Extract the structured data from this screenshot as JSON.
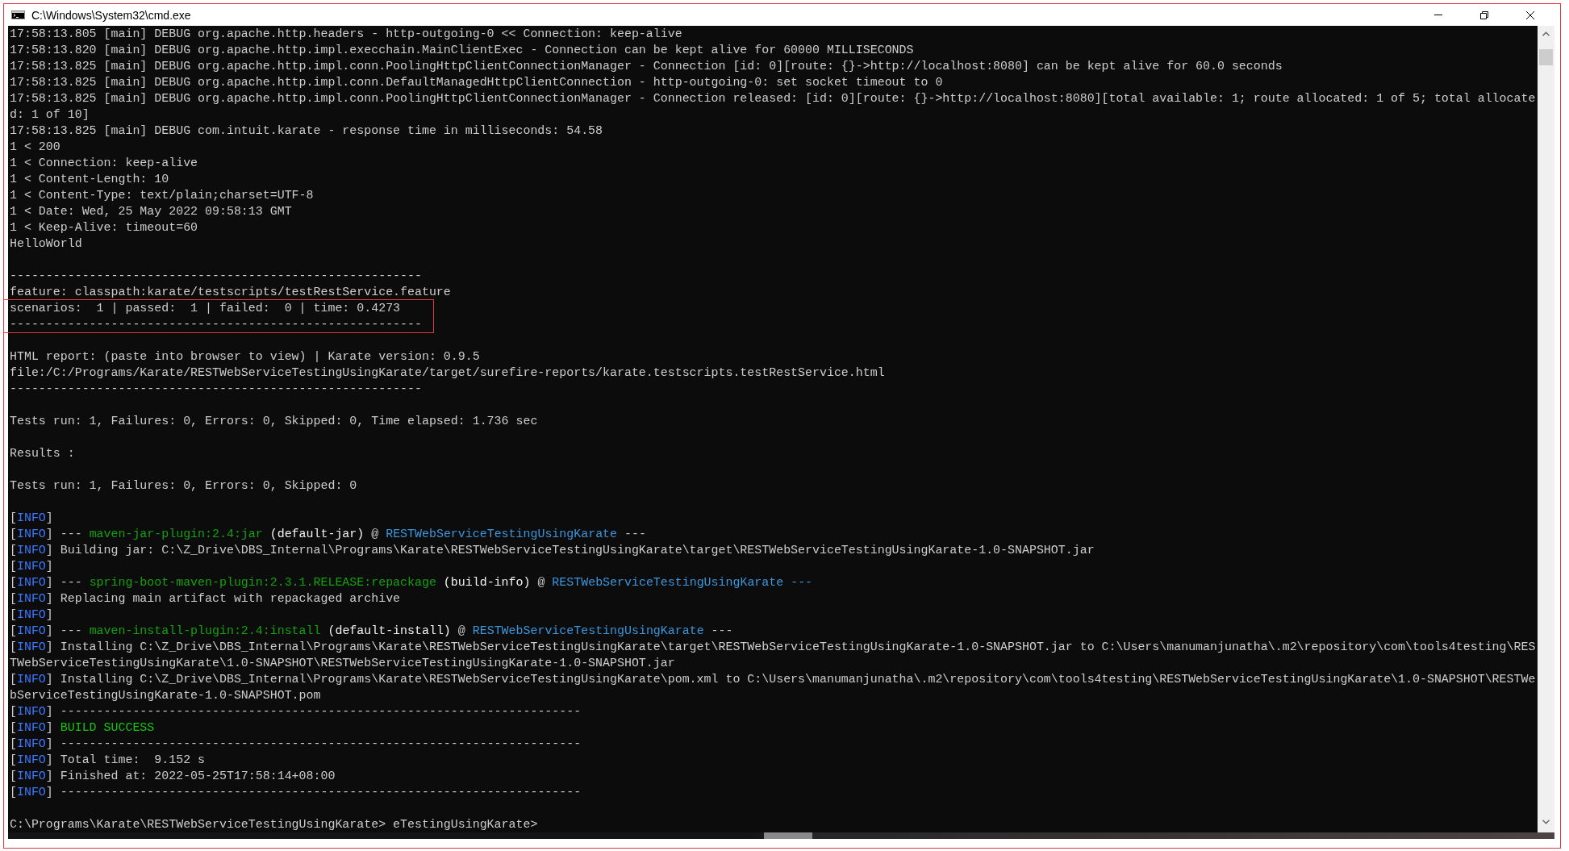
{
  "window": {
    "title": "C:\\Windows\\System32\\cmd.exe"
  },
  "console": {
    "blocks": [
      {
        "highlighted": false,
        "lines": [
          {
            "kind": "text",
            "text": "17:58:13.805 [main] DEBUG org.apache.http.headers - http-outgoing-0 << Connection: keep-alive"
          },
          {
            "kind": "text",
            "text": "17:58:13.820 [main] DEBUG org.apache.http.impl.execchain.MainClientExec - Connection can be kept alive for 60000 MILLISECONDS"
          },
          {
            "kind": "text",
            "text": "17:58:13.825 [main] DEBUG org.apache.http.impl.conn.PoolingHttpClientConnectionManager - Connection [id: 0][route: {}->http://localhost:8080] can be kept alive for 60.0 seconds"
          },
          {
            "kind": "text",
            "text": "17:58:13.825 [main] DEBUG org.apache.http.impl.conn.DefaultManagedHttpClientConnection - http-outgoing-0: set socket timeout to 0"
          },
          {
            "kind": "text",
            "text": "17:58:13.825 [main] DEBUG org.apache.http.impl.conn.PoolingHttpClientConnectionManager - Connection released: [id: 0][route: {}->http://localhost:8080][total available: 1; route allocated: 1 of 5; total allocate"
          },
          {
            "kind": "text",
            "text": "d: 1 of 10]"
          },
          {
            "kind": "text",
            "text": "17:58:13.825 [main] DEBUG com.intuit.karate - response time in milliseconds: 54.58"
          },
          {
            "kind": "text",
            "text": "1 < 200"
          },
          {
            "kind": "text",
            "text": "1 < Connection: keep-alive"
          },
          {
            "kind": "text",
            "text": "1 < Content-Length: 10"
          },
          {
            "kind": "text",
            "text": "1 < Content-Type: text/plain;charset=UTF-8"
          },
          {
            "kind": "text",
            "text": "1 < Date: Wed, 25 May 2022 09:58:13 GMT"
          },
          {
            "kind": "text",
            "text": "1 < Keep-Alive: timeout=60"
          },
          {
            "kind": "text",
            "text": "HelloWorld"
          },
          {
            "kind": "blank"
          },
          {
            "kind": "text",
            "text": "---------------------------------------------------------"
          },
          {
            "kind": "text",
            "text": "feature: classpath:karate/testscripts/testRestService.feature"
          }
        ]
      },
      {
        "highlighted": true,
        "lines": [
          {
            "kind": "text",
            "text": "scenarios:  1 | passed:  1 | failed:  0 | time: 0.4273"
          },
          {
            "kind": "text",
            "text": "---------------------------------------------------------"
          }
        ]
      },
      {
        "highlighted": false,
        "lines": [
          {
            "kind": "blank"
          },
          {
            "kind": "text",
            "text": "HTML report: (paste into browser to view) | Karate version: 0.9.5"
          },
          {
            "kind": "text",
            "text": "file:/C:/Programs/Karate/RESTWebServiceTestingUsingKarate/target/surefire-reports/karate.testscripts.testRestService.html"
          },
          {
            "kind": "text",
            "text": "---------------------------------------------------------"
          },
          {
            "kind": "blank"
          },
          {
            "kind": "text",
            "text": "Tests run: 1, Failures: 0, Errors: 0, Skipped: 0, Time elapsed: 1.736 sec"
          },
          {
            "kind": "blank"
          },
          {
            "kind": "text",
            "text": "Results :"
          },
          {
            "kind": "blank"
          },
          {
            "kind": "text",
            "text": "Tests run: 1, Failures: 0, Errors: 0, Skipped: 0"
          },
          {
            "kind": "blank"
          },
          {
            "kind": "colored",
            "segments": [
              {
                "kind": "text",
                "text": "["
              },
              {
                "kind": "info",
                "text": "INFO"
              },
              {
                "kind": "text",
                "text": "]"
              }
            ]
          },
          {
            "kind": "colored",
            "segments": [
              {
                "kind": "text",
                "text": "["
              },
              {
                "kind": "info",
                "text": "INFO"
              },
              {
                "kind": "text",
                "text": "] --- "
              },
              {
                "kind": "plugin",
                "text": "maven-jar-plugin:2.4:jar"
              },
              {
                "kind": "bold",
                "text": " (default-jar)"
              },
              {
                "kind": "text",
                "text": " @ "
              },
              {
                "kind": "project",
                "text": "RESTWebServiceTestingUsingKarate"
              },
              {
                "kind": "text",
                "text": " ---"
              }
            ]
          },
          {
            "kind": "colored",
            "segments": [
              {
                "kind": "text",
                "text": "["
              },
              {
                "kind": "info",
                "text": "INFO"
              },
              {
                "kind": "text",
                "text": "] Building jar: C:\\Z_Drive\\DBS_Internal\\Programs\\Karate\\RESTWebServiceTestingUsingKarate\\target\\RESTWebServiceTestingUsingKarate-1.0-SNAPSHOT.jar"
              }
            ]
          },
          {
            "kind": "colored",
            "segments": [
              {
                "kind": "text",
                "text": "["
              },
              {
                "kind": "info",
                "text": "INFO"
              },
              {
                "kind": "text",
                "text": "]"
              }
            ]
          },
          {
            "kind": "colored",
            "segments": [
              {
                "kind": "text",
                "text": "["
              },
              {
                "kind": "info",
                "text": "INFO"
              },
              {
                "kind": "text",
                "text": "] --- "
              },
              {
                "kind": "plugin",
                "text": "spring-boot-maven-plugin:2.3.1.RELEASE:repackage"
              },
              {
                "kind": "bold",
                "text": " (build-info)"
              },
              {
                "kind": "text",
                "text": " @ "
              },
              {
                "kind": "project",
                "text": "RESTWebServiceTestingUsingKarate ---"
              }
            ]
          },
          {
            "kind": "colored",
            "segments": [
              {
                "kind": "text",
                "text": "["
              },
              {
                "kind": "info",
                "text": "INFO"
              },
              {
                "kind": "text",
                "text": "] Replacing main artifact with repackaged archive"
              }
            ]
          },
          {
            "kind": "colored",
            "segments": [
              {
                "kind": "text",
                "text": "["
              },
              {
                "kind": "info",
                "text": "INFO"
              },
              {
                "kind": "text",
                "text": "]"
              }
            ]
          },
          {
            "kind": "colored",
            "segments": [
              {
                "kind": "text",
                "text": "["
              },
              {
                "kind": "info",
                "text": "INFO"
              },
              {
                "kind": "text",
                "text": "] --- "
              },
              {
                "kind": "plugin",
                "text": "maven-install-plugin:2.4:install"
              },
              {
                "kind": "bold",
                "text": " (default-install)"
              },
              {
                "kind": "text",
                "text": " @ "
              },
              {
                "kind": "project",
                "text": "RESTWebServiceTestingUsingKarate"
              },
              {
                "kind": "text",
                "text": " ---"
              }
            ]
          },
          {
            "kind": "colored",
            "segments": [
              {
                "kind": "text",
                "text": "["
              },
              {
                "kind": "info",
                "text": "INFO"
              },
              {
                "kind": "text",
                "text": "] Installing C:\\Z_Drive\\DBS_Internal\\Programs\\Karate\\RESTWebServiceTestingUsingKarate\\target\\RESTWebServiceTestingUsingKarate-1.0-SNAPSHOT.jar to C:\\Users\\manumanjunatha\\.m2\\repository\\com\\tools4testing\\RES"
              }
            ]
          },
          {
            "kind": "text",
            "text": "TWebServiceTestingUsingKarate\\1.0-SNAPSHOT\\RESTWebServiceTestingUsingKarate-1.0-SNAPSHOT.jar"
          },
          {
            "kind": "colored",
            "segments": [
              {
                "kind": "text",
                "text": "["
              },
              {
                "kind": "info",
                "text": "INFO"
              },
              {
                "kind": "text",
                "text": "] Installing C:\\Z_Drive\\DBS_Internal\\Programs\\Karate\\RESTWebServiceTestingUsingKarate\\pom.xml to C:\\Users\\manumanjunatha\\.m2\\repository\\com\\tools4testing\\RESTWebServiceTestingUsingKarate\\1.0-SNAPSHOT\\RESTWe"
              }
            ]
          },
          {
            "kind": "text",
            "text": "bServiceTestingUsingKarate-1.0-SNAPSHOT.pom"
          },
          {
            "kind": "colored",
            "segments": [
              {
                "kind": "text",
                "text": "["
              },
              {
                "kind": "info",
                "text": "INFO"
              },
              {
                "kind": "text",
                "text": "] ------------------------------------------------------------------------"
              }
            ]
          },
          {
            "kind": "colored",
            "segments": [
              {
                "kind": "text",
                "text": "["
              },
              {
                "kind": "info",
                "text": "INFO"
              },
              {
                "kind": "text",
                "text": "] "
              },
              {
                "kind": "success",
                "text": "BUILD SUCCESS"
              }
            ]
          },
          {
            "kind": "colored",
            "segments": [
              {
                "kind": "text",
                "text": "["
              },
              {
                "kind": "info",
                "text": "INFO"
              },
              {
                "kind": "text",
                "text": "] ------------------------------------------------------------------------"
              }
            ]
          },
          {
            "kind": "colored",
            "segments": [
              {
                "kind": "text",
                "text": "["
              },
              {
                "kind": "info",
                "text": "INFO"
              },
              {
                "kind": "text",
                "text": "] Total time:  9.152 s"
              }
            ]
          },
          {
            "kind": "colored",
            "segments": [
              {
                "kind": "text",
                "text": "["
              },
              {
                "kind": "info",
                "text": "INFO"
              },
              {
                "kind": "text",
                "text": "] Finished at: 2022-05-25T17:58:14+08:00"
              }
            ]
          },
          {
            "kind": "colored",
            "segments": [
              {
                "kind": "text",
                "text": "["
              },
              {
                "kind": "info",
                "text": "INFO"
              },
              {
                "kind": "text",
                "text": "] ------------------------------------------------------------------------"
              }
            ]
          },
          {
            "kind": "blank"
          },
          {
            "kind": "text",
            "text": "C:\\Programs\\Karate\\RESTWebServiceTestingUsingKarate> eTestingUsingKarate>"
          }
        ]
      }
    ]
  }
}
